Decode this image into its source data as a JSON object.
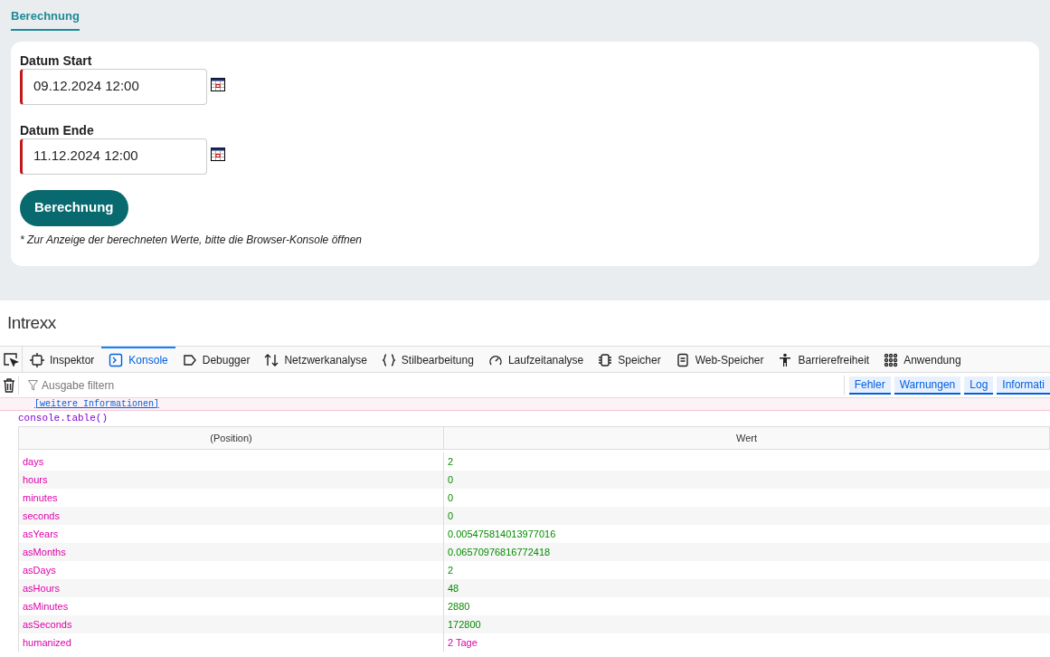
{
  "tabs": [
    {
      "label": "Berechnung",
      "selected": true
    }
  ],
  "form": {
    "fields": [
      {
        "label": "Datum Start",
        "value": "09.12.2024 12:00",
        "required": true
      },
      {
        "label": "Datum Ende",
        "value": "11.12.2024 12:00",
        "required": true
      }
    ],
    "button": "Berechnung",
    "note": "* Zur Anzeige der berechneten Werte, bitte die Browser-Konsole öffnen"
  },
  "logo": "Intrexx",
  "devtools": {
    "tabs": [
      {
        "label": "Inspektor",
        "selected": false
      },
      {
        "label": "Konsole",
        "selected": true
      },
      {
        "label": "Debugger",
        "selected": false
      },
      {
        "label": "Netzwerkanalyse",
        "selected": false
      },
      {
        "label": "Stilbearbeitung",
        "selected": false
      },
      {
        "label": "Laufzeitanalyse",
        "selected": false
      },
      {
        "label": "Speicher",
        "selected": false
      },
      {
        "label": "Web-Speicher",
        "selected": false
      },
      {
        "label": "Barrierefreiheit",
        "selected": false
      },
      {
        "label": "Anwendung",
        "selected": false
      }
    ],
    "filter_placeholder": "Ausgabe filtern",
    "levels": [
      {
        "label": "Fehler",
        "selected": true
      },
      {
        "label": "Warnungen",
        "selected": true
      },
      {
        "label": "Log",
        "selected": true
      },
      {
        "label": "Informati",
        "selected": true
      }
    ],
    "error_link": "[weitere Informationen]",
    "command": "console.table()",
    "table": {
      "columns": [
        "(Position)",
        "Wert"
      ],
      "rows": [
        {
          "key": "days",
          "value": "2",
          "kind": "number"
        },
        {
          "key": "hours",
          "value": "0",
          "kind": "number"
        },
        {
          "key": "minutes",
          "value": "0",
          "kind": "number"
        },
        {
          "key": "seconds",
          "value": "0",
          "kind": "number"
        },
        {
          "key": "asYears",
          "value": "0.005475814013977016",
          "kind": "number"
        },
        {
          "key": "asMonths",
          "value": "0.06570976816772418",
          "kind": "number"
        },
        {
          "key": "asDays",
          "value": "2",
          "kind": "number"
        },
        {
          "key": "asHours",
          "value": "48",
          "kind": "number"
        },
        {
          "key": "asMinutes",
          "value": "2880",
          "kind": "number"
        },
        {
          "key": "asSeconds",
          "value": "172800",
          "kind": "number"
        },
        {
          "key": "humanized",
          "value": "2 Tage",
          "kind": "string"
        }
      ]
    }
  }
}
